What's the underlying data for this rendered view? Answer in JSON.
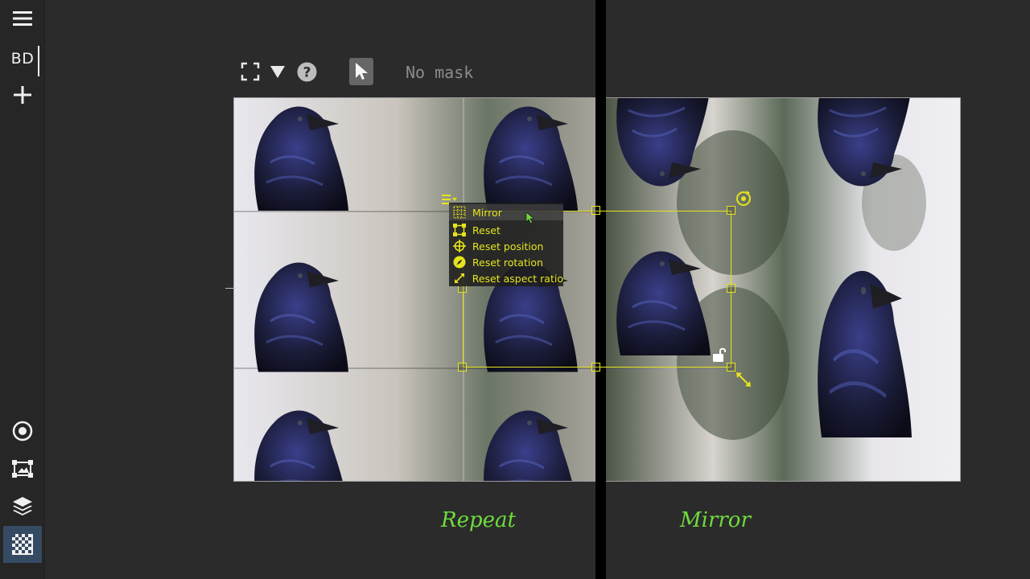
{
  "sidebar": {
    "menu_icon": "hamburger-menu-icon",
    "workspace_label": "BD",
    "add_icon": "plus-icon",
    "bottom_icons": [
      "target-icon",
      "transform-icon",
      "layers-icon",
      "checkerboard-icon"
    ]
  },
  "toolbar": {
    "fullscreen_icon": "fullscreen-icon",
    "dropdown_icon": "triangle-down-icon",
    "help_icon": "help-circle-icon",
    "select_tool_icon": "pointer-arrow-icon",
    "mask_label": "No mask"
  },
  "context_menu": {
    "items": [
      {
        "label": "Mirror",
        "icon": "grid-dots-icon"
      },
      {
        "label": "Reset",
        "icon": "reset-square-icon"
      },
      {
        "label": "Reset position",
        "icon": "crosshair-icon"
      },
      {
        "label": "Reset rotation",
        "icon": "compass-icon"
      },
      {
        "label": "Reset aspect ratio",
        "icon": "diagonal-arrows-icon"
      }
    ]
  },
  "annotations": {
    "left": "Repeat",
    "right": "Mirror"
  },
  "colors": {
    "accent": "#e6e41c",
    "annotation": "#6fdc3c",
    "background": "#2b2b2b",
    "sidebar_selected": "#354a63"
  }
}
